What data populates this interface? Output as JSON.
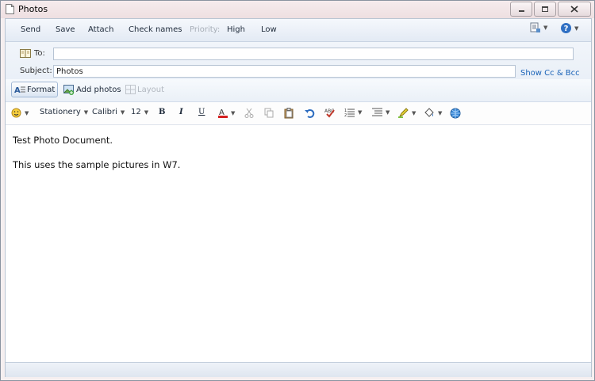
{
  "window": {
    "title": "Photos"
  },
  "toolbar": {
    "send": "Send",
    "save": "Save",
    "attach": "Attach",
    "check_names": "Check names",
    "priority_label": "Priority:",
    "high": "High",
    "low": "Low"
  },
  "header": {
    "to_label": "To:",
    "to_value": "",
    "subject_label": "Subject:",
    "subject_value": "Photos",
    "show_cc_bcc": "Show Cc & Bcc"
  },
  "format_bar": {
    "format": "Format",
    "add_photos": "Add photos",
    "layout": "Layout"
  },
  "text_bar": {
    "stationery": "Stationery",
    "font": "Calibri",
    "size": "12",
    "bold": "B",
    "italic": "I",
    "underline": "U"
  },
  "message": {
    "line1": "Test Photo Document.",
    "line2": "This uses the sample pictures in W7."
  },
  "colors": {
    "link": "#1a63b8",
    "font_color_bar": "#d42020",
    "toolbar_bg": "#e3eaf4"
  }
}
